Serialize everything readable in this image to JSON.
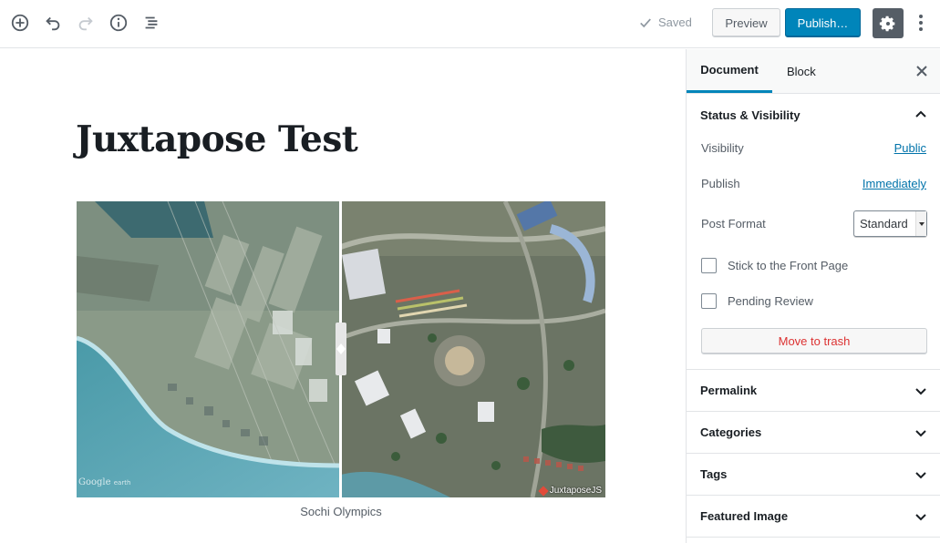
{
  "toolbar": {
    "saved_label": "Saved",
    "preview_label": "Preview",
    "publish_label": "Publish…"
  },
  "post": {
    "title": "Juxtapose Test",
    "caption": "Sochi Olympics",
    "left_credit": "Google",
    "left_credit_sub": "earth",
    "right_credit": "JuxtaposeJS"
  },
  "sidebar": {
    "tabs": [
      {
        "label": "Document",
        "active": true
      },
      {
        "label": "Block",
        "active": false
      }
    ],
    "status_panel": {
      "title": "Status & Visibility",
      "visibility_label": "Visibility",
      "visibility_value": "Public",
      "publish_label": "Publish",
      "publish_value": "Immediately",
      "post_format_label": "Post Format",
      "post_format_value": "Standard",
      "stick_label": "Stick to the Front Page",
      "stick_checked": false,
      "pending_label": "Pending Review",
      "pending_checked": false,
      "trash_label": "Move to trash"
    },
    "panels": [
      {
        "title": "Permalink"
      },
      {
        "title": "Categories"
      },
      {
        "title": "Tags"
      },
      {
        "title": "Featured Image"
      }
    ]
  },
  "colors": {
    "accent": "#0085ba",
    "link": "#0073aa",
    "danger": "#dc3232",
    "settings_active": "#555d66"
  }
}
